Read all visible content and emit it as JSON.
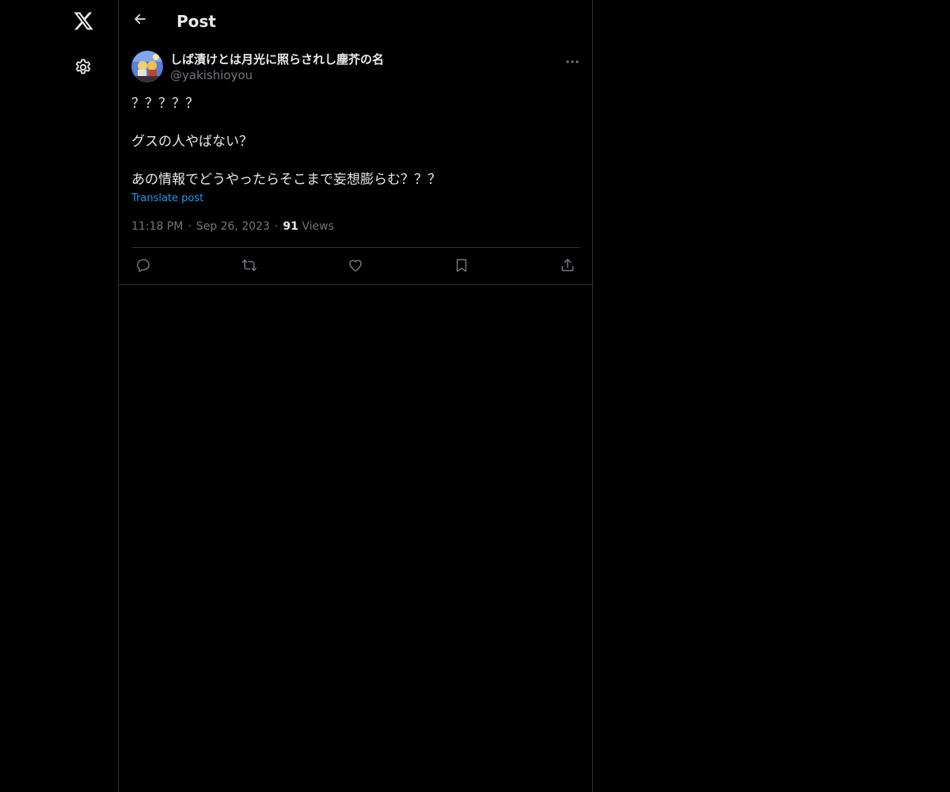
{
  "nav": {
    "logo_icon": "x-logo-icon",
    "settings_icon": "gear-icon"
  },
  "header": {
    "title": "Post",
    "back_icon": "arrow-left-icon"
  },
  "tweet": {
    "author": {
      "display_name": "しば漬けとは月光に照らされし塵芥の名",
      "handle": "@yakishioyou"
    },
    "lines": [
      "？？？？？",
      "",
      "グスの人やばない？",
      "",
      "あの情報でどうやったらそこまで妄想膨らむ？？？"
    ],
    "translate_label": "Translate post",
    "time": "11:18 PM",
    "date": "Sep 26, 2023",
    "views_count": "91",
    "views_label": "Views",
    "separator": "·"
  },
  "actions": {
    "reply_icon": "reply-icon",
    "repost_icon": "repost-icon",
    "like_icon": "heart-icon",
    "bookmark_icon": "bookmark-icon",
    "share_icon": "share-icon"
  },
  "colors": {
    "background": "#000000",
    "text_primary": "#e7e9ea",
    "text_secondary": "#71767b",
    "accent": "#1d9bf0",
    "border": "#2f3336"
  }
}
